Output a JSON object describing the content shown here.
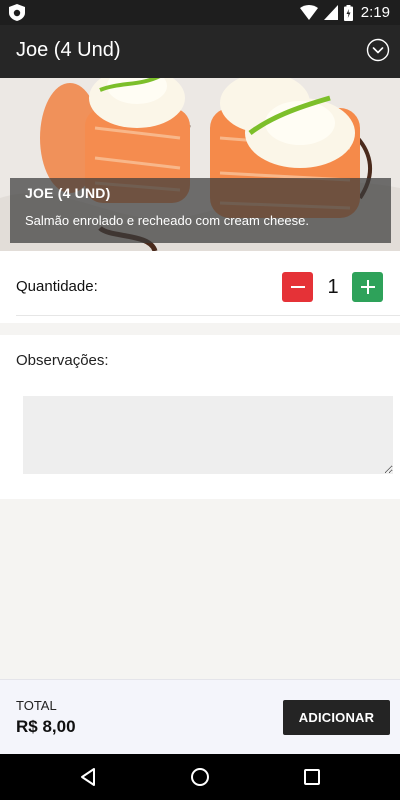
{
  "status_bar": {
    "time": "2:19"
  },
  "toolbar": {
    "title": "Joe (4 Und)"
  },
  "product": {
    "name": "JOE (4 UND)",
    "description": "Salmão enrolado e recheado com cream cheese."
  },
  "quantity": {
    "label": "Quantidade:",
    "value": "1"
  },
  "observations": {
    "label": "Observações:",
    "placeholder": ""
  },
  "footer": {
    "total_label": "TOTAL",
    "total_value": "R$ 8,00",
    "add_label": "ADICIONAR"
  },
  "colors": {
    "minus": "#e53237",
    "plus": "#2ea25a",
    "toolbar": "#262626"
  }
}
